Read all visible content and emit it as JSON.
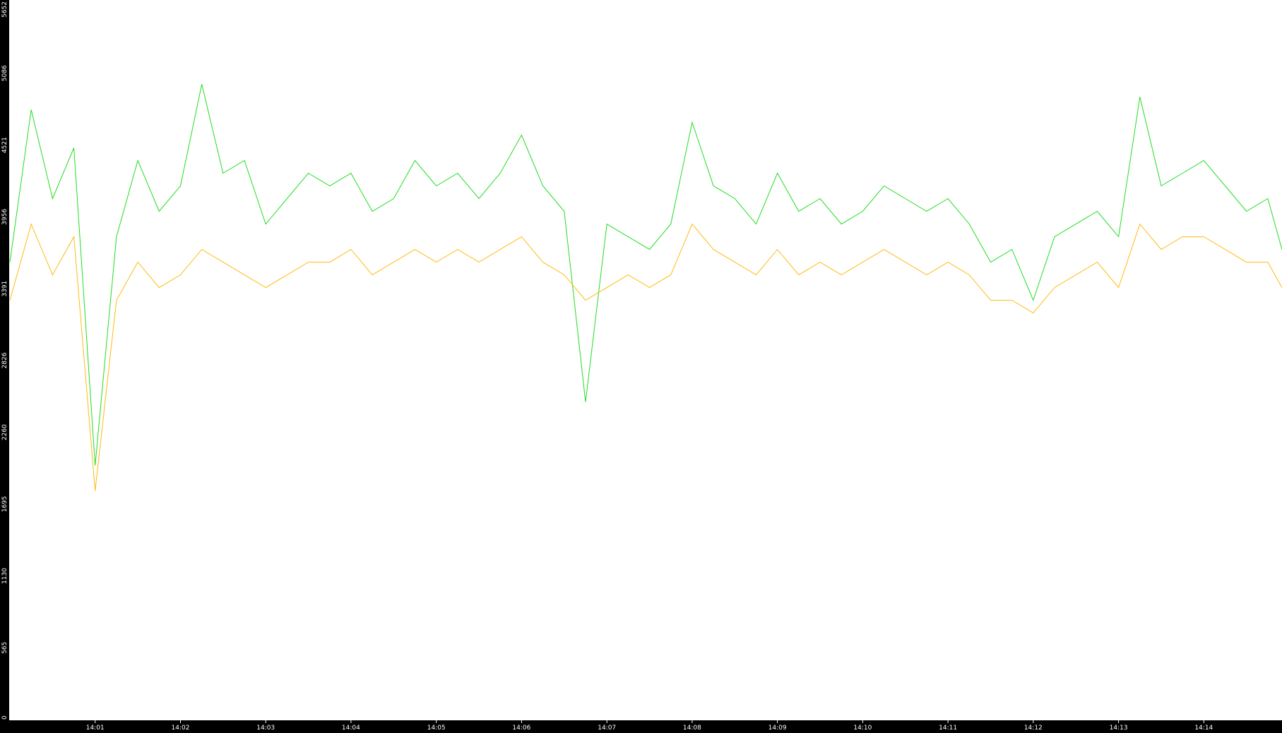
{
  "chart_data": {
    "type": "line",
    "title": "",
    "xlabel": "",
    "ylabel": "",
    "ylim": [
      0,
      5652
    ],
    "y_ticks": [
      "0",
      "565",
      "1130",
      "1695",
      "2260",
      "2826",
      "3391",
      "3956",
      "4521",
      "5086",
      "5652"
    ],
    "x_ticks": [
      "14:01",
      "14:02",
      "14:03",
      "14:04",
      "14:05",
      "14:06",
      "14:07",
      "14:08",
      "14:09",
      "14:10",
      "14:11",
      "14:12",
      "14:13",
      "14:14"
    ],
    "x_range": [
      "14:00:00",
      "14:14:55"
    ],
    "grid": false,
    "legend": "none",
    "series": [
      {
        "color": "#22dd22",
        "time": [
          "14:00:00",
          "14:00:15",
          "14:00:30",
          "14:00:45",
          "14:01:00",
          "14:01:15",
          "14:01:30",
          "14:01:45",
          "14:02:00",
          "14:02:15",
          "14:02:30",
          "14:02:45",
          "14:03:00",
          "14:03:15",
          "14:03:30",
          "14:03:45",
          "14:04:00",
          "14:04:15",
          "14:04:30",
          "14:04:45",
          "14:05:00",
          "14:05:15",
          "14:05:30",
          "14:05:45",
          "14:06:00",
          "14:06:15",
          "14:06:30",
          "14:06:45",
          "14:07:00",
          "14:07:15",
          "14:07:30",
          "14:07:45",
          "14:08:00",
          "14:08:15",
          "14:08:30",
          "14:08:45",
          "14:09:00",
          "14:09:15",
          "14:09:30",
          "14:09:45",
          "14:10:00",
          "14:10:15",
          "14:10:30",
          "14:10:45",
          "14:11:00",
          "14:11:15",
          "14:11:30",
          "14:11:45",
          "14:12:00",
          "14:12:15",
          "14:12:30",
          "14:12:45",
          "14:13:00",
          "14:13:15",
          "14:13:30",
          "14:13:45",
          "14:14:00",
          "14:14:15",
          "14:14:30",
          "14:14:45",
          "14:14:55"
        ],
        "values": [
          3600,
          4800,
          4100,
          4500,
          2000,
          3800,
          4400,
          4000,
          4200,
          5000,
          4300,
          4400,
          3900,
          4100,
          4300,
          4200,
          4300,
          4000,
          4100,
          4400,
          4200,
          4300,
          4100,
          4300,
          4600,
          4200,
          4000,
          2500,
          3900,
          3800,
          3700,
          3900,
          4700,
          4200,
          4100,
          3900,
          4300,
          4000,
          4100,
          3900,
          4000,
          4200,
          4100,
          4000,
          4100,
          3900,
          3600,
          3700,
          3300,
          3800,
          3900,
          4000,
          3800,
          4900,
          4200,
          4300,
          4400,
          4200,
          4000,
          4100,
          3700
        ]
      },
      {
        "color": "#ffbb11",
        "time": [
          "14:00:00",
          "14:00:15",
          "14:00:30",
          "14:00:45",
          "14:01:00",
          "14:01:15",
          "14:01:30",
          "14:01:45",
          "14:02:00",
          "14:02:15",
          "14:02:30",
          "14:02:45",
          "14:03:00",
          "14:03:15",
          "14:03:30",
          "14:03:45",
          "14:04:00",
          "14:04:15",
          "14:04:30",
          "14:04:45",
          "14:05:00",
          "14:05:15",
          "14:05:30",
          "14:05:45",
          "14:06:00",
          "14:06:15",
          "14:06:30",
          "14:06:45",
          "14:07:00",
          "14:07:15",
          "14:07:30",
          "14:07:45",
          "14:08:00",
          "14:08:15",
          "14:08:30",
          "14:08:45",
          "14:09:00",
          "14:09:15",
          "14:09:30",
          "14:09:45",
          "14:10:00",
          "14:10:15",
          "14:10:30",
          "14:10:45",
          "14:11:00",
          "14:11:15",
          "14:11:30",
          "14:11:45",
          "14:12:00",
          "14:12:15",
          "14:12:30",
          "14:12:45",
          "14:13:00",
          "14:13:15",
          "14:13:30",
          "14:13:45",
          "14:14:00",
          "14:14:15",
          "14:14:30",
          "14:14:45",
          "14:14:55"
        ],
        "values": [
          3300,
          3900,
          3500,
          3800,
          1800,
          3300,
          3600,
          3400,
          3500,
          3700,
          3600,
          3500,
          3400,
          3500,
          3600,
          3600,
          3700,
          3500,
          3600,
          3700,
          3600,
          3700,
          3600,
          3700,
          3800,
          3600,
          3500,
          3300,
          3400,
          3500,
          3400,
          3500,
          3900,
          3700,
          3600,
          3500,
          3700,
          3500,
          3600,
          3500,
          3600,
          3700,
          3600,
          3500,
          3600,
          3500,
          3300,
          3300,
          3200,
          3400,
          3500,
          3600,
          3400,
          3900,
          3700,
          3800,
          3800,
          3700,
          3600,
          3600,
          3400
        ]
      }
    ]
  }
}
